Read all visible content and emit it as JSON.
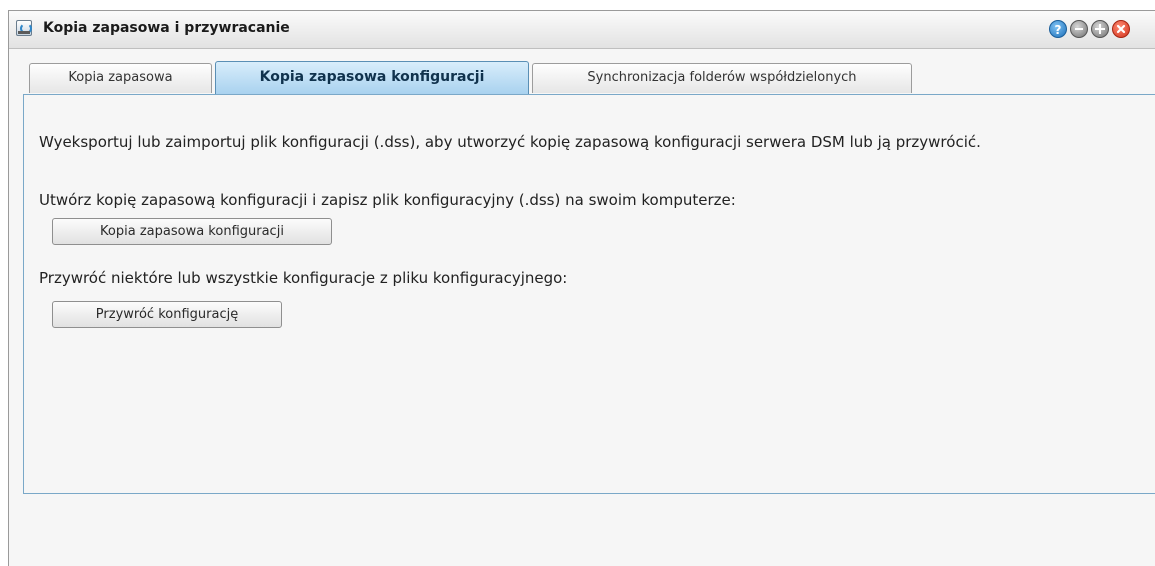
{
  "window": {
    "title": "Kopia zapasowa i przywracanie",
    "help_icon_glyph": "?"
  },
  "tabs": [
    {
      "label": "Kopia zapasowa",
      "active": false
    },
    {
      "label": "Kopia zapasowa konfiguracji",
      "active": true
    },
    {
      "label": "Synchronizacja folderów współdzielonych",
      "active": false
    }
  ],
  "content": {
    "description": "Wyeksportuj lub zaimportuj plik konfiguracji (.dss), aby utworzyć kopię zapasową konfiguracji serwera DSM lub ją przywrócić.",
    "backup_prompt": "Utwórz kopię zapasową konfiguracji i zapisz plik konfiguracyjny (.dss) na swoim komputerze:",
    "backup_button": "Kopia zapasowa konfiguracji",
    "restore_prompt": "Przywróć niektóre lub wszystkie konfiguracje z pliku konfiguracyjnego:",
    "restore_button": "Przywróć konfigurację"
  },
  "colors": {
    "active_tab": "#a9d2ef",
    "panel_border": "#7aa8c8",
    "close_button": "#d1301a",
    "help_button": "#1d6fb8"
  },
  "icons": [
    "backup-app-icon",
    "help-icon",
    "minimize-icon",
    "maximize-icon",
    "close-icon"
  ]
}
